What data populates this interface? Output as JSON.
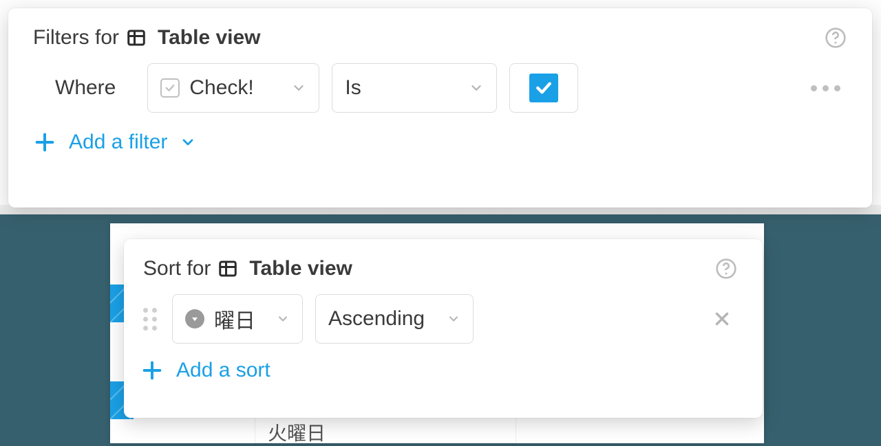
{
  "filters": {
    "title_prefix": "Filters for",
    "view_name": "Table view",
    "where_label": "Where",
    "rules": [
      {
        "field": "Check!",
        "operator": "Is",
        "value_checked": true
      }
    ],
    "add_label": "Add a filter"
  },
  "sort": {
    "title_prefix": "Sort for",
    "view_name": "Table view",
    "rules": [
      {
        "field": "曜日",
        "order": "Ascending"
      }
    ],
    "add_label": "Add a sort"
  },
  "bg_text": "火曜日"
}
